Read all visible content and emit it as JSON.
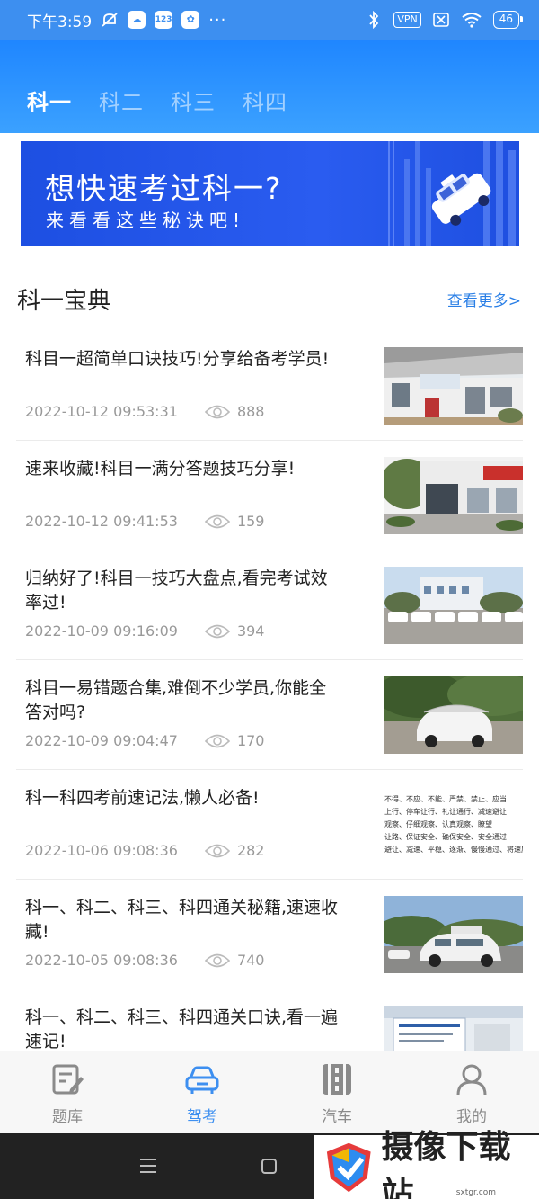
{
  "status_bar": {
    "time": "下午3:59",
    "vpn_label": "VPN",
    "battery": "46",
    "app_badge": "123",
    "more": "···"
  },
  "tabs": [
    {
      "label": "科一",
      "active": true
    },
    {
      "label": "科二",
      "active": false
    },
    {
      "label": "科三",
      "active": false
    },
    {
      "label": "科四",
      "active": false
    }
  ],
  "banner": {
    "title": "想快速考过科一?",
    "subtitle": "来看看这些秘诀吧!"
  },
  "section": {
    "title": "科一宝典",
    "more_label": "查看更多>"
  },
  "articles": [
    {
      "title": "科目一超简单口诀技巧!分享给备考学员!",
      "date": "2022-10-12 09:53:31",
      "views": "888",
      "thumb": "building-photo"
    },
    {
      "title": "速来收藏!科目一满分答题技巧分享!",
      "date": "2022-10-12 09:41:53",
      "views": "159",
      "thumb": "building-photo"
    },
    {
      "title": "归纳好了!科目一技巧大盘点,看完考试效率过!",
      "date": "2022-10-09 09:16:09",
      "views": "394",
      "thumb": "cars-photo"
    },
    {
      "title": "科目一易错题合集,难倒不少学员,你能全答对吗?",
      "date": "2022-10-09 09:04:47",
      "views": "170",
      "thumb": "car-photo"
    },
    {
      "title": "科一科四考前速记法,懒人必备!",
      "date": "2022-10-06 09:08:36",
      "views": "282",
      "thumb": "text-image"
    },
    {
      "title": "科一、科二、科三、科四通关秘籍,速速收藏!",
      "date": "2022-10-05 09:08:36",
      "views": "740",
      "thumb": "car-photo"
    },
    {
      "title": "科一、科二、科三、科四通关口诀,看一遍速记!",
      "date": "",
      "views": "",
      "thumb": "building-photo"
    }
  ],
  "thumb_text_lines": [
    "不得、不应、不能、严禁、禁止、应当",
    "上行、停车让行、礼让通行、减速避让",
    "观察、仔细观察、认真观察、瞭望",
    "让路、保证安全、确保安全、安全通过",
    "避让、减速、平稳、逐渐、慢慢通过、将速度"
  ],
  "bottom_nav": [
    {
      "label": "题库",
      "icon": "question-bank-icon",
      "active": false
    },
    {
      "label": "驾考",
      "icon": "car-icon",
      "active": true
    },
    {
      "label": "汽车",
      "icon": "vehicle-icon",
      "active": false
    },
    {
      "label": "我的",
      "icon": "user-icon",
      "active": false
    }
  ],
  "watermark": {
    "text": "摄像下载站",
    "url": "sxtgr.com"
  },
  "colors": {
    "primary": "#3d8ff0",
    "header": "#1f86ff",
    "banner": "#1d4fe2",
    "link": "#2a7fe6"
  }
}
